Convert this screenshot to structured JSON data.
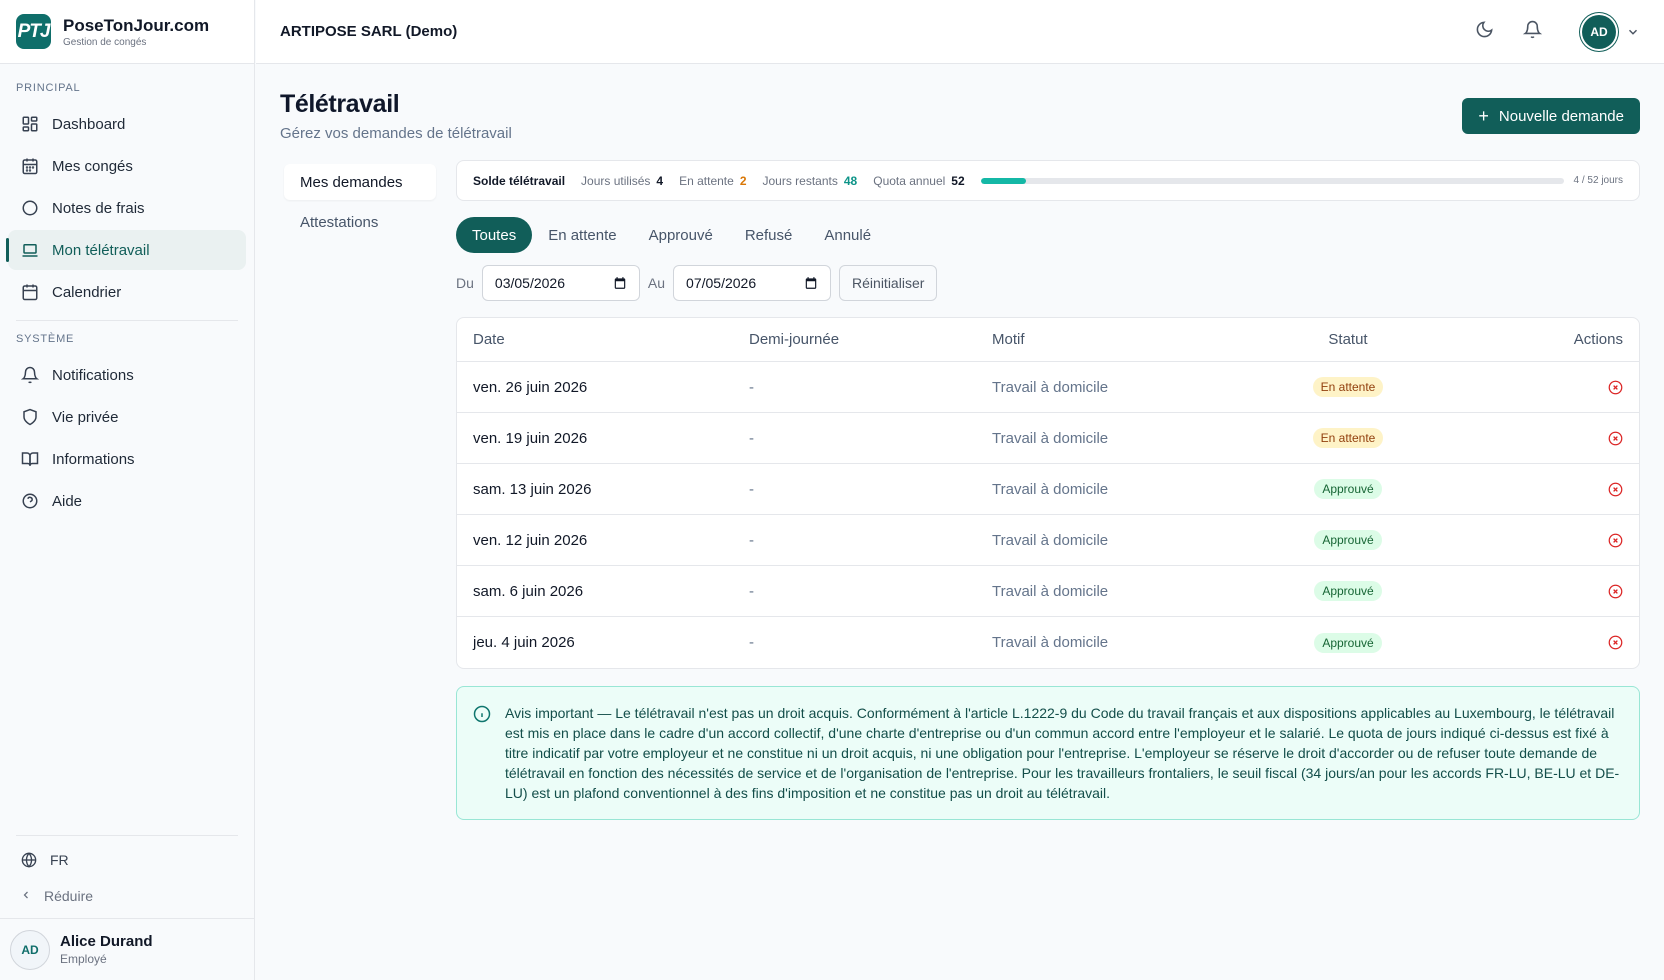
{
  "brand": {
    "logo": "PTJ",
    "name": "PoseTonJour.com",
    "tagline": "Gestion de congés"
  },
  "sidebar": {
    "principal_title": "PRINCIPAL",
    "principal_items": [
      {
        "label": "Dashboard",
        "icon": "dashboard-icon"
      },
      {
        "label": "Mes congés",
        "icon": "calendar-grid-icon"
      },
      {
        "label": "Notes de frais",
        "icon": "circle-icon"
      },
      {
        "label": "Mon télétravail",
        "icon": "laptop-icon",
        "active": true
      },
      {
        "label": "Calendrier",
        "icon": "calendar-icon"
      }
    ],
    "system_title": "SYSTÈME",
    "system_items": [
      {
        "label": "Notifications",
        "icon": "bell-icon"
      },
      {
        "label": "Vie privée",
        "icon": "shield-icon"
      },
      {
        "label": "Informations",
        "icon": "book-icon"
      },
      {
        "label": "Aide",
        "icon": "help-icon"
      }
    ],
    "language": "FR",
    "collapse_label": "Réduire",
    "user": {
      "initials": "AD",
      "name": "Alice Durand",
      "role": "Employé"
    }
  },
  "header": {
    "company": "ARTIPOSE SARL (Demo)",
    "avatar_initials": "AD"
  },
  "page": {
    "title": "Télétravail",
    "subtitle": "Gérez vos demandes de télétravail",
    "new_button": "Nouvelle demande",
    "subnav": [
      "Mes demandes",
      "Attestations"
    ]
  },
  "balance": {
    "title": "Solde télétravail",
    "used_label": "Jours utilisés",
    "used_value": "4",
    "pending_label": "En attente",
    "pending_value": "2",
    "remaining_label": "Jours restants",
    "remaining_value": "48",
    "quota_label": "Quota annuel",
    "quota_value": "52",
    "progress_fraction": 0.077,
    "progress_text": "4 / 52 jours"
  },
  "tabs": [
    "Toutes",
    "En attente",
    "Approuvé",
    "Refusé",
    "Annulé"
  ],
  "filters": {
    "from_label": "Du",
    "from_value": "03/05/2026",
    "to_label": "Au",
    "to_value": "07/05/2026",
    "reset_label": "Réinitialiser"
  },
  "table": {
    "headers": [
      "Date",
      "Demi-journée",
      "Motif",
      "Statut",
      "Actions"
    ],
    "rows": [
      {
        "date": "ven. 26 juin 2026",
        "half": "-",
        "motif": "Travail à domicile",
        "status": "En attente",
        "kind": "pending"
      },
      {
        "date": "ven. 19 juin 2026",
        "half": "-",
        "motif": "Travail à domicile",
        "status": "En attente",
        "kind": "pending"
      },
      {
        "date": "sam. 13 juin 2026",
        "half": "-",
        "motif": "Travail à domicile",
        "status": "Approuvé",
        "kind": "approved"
      },
      {
        "date": "ven. 12 juin 2026",
        "half": "-",
        "motif": "Travail à domicile",
        "status": "Approuvé",
        "kind": "approved"
      },
      {
        "date": "sam. 6 juin 2026",
        "half": "-",
        "motif": "Travail à domicile",
        "status": "Approuvé",
        "kind": "approved"
      },
      {
        "date": "jeu. 4 juin 2026",
        "half": "-",
        "motif": "Travail à domicile",
        "status": "Approuvé",
        "kind": "approved"
      }
    ]
  },
  "notice": "Avis important — Le télétravail n'est pas un droit acquis. Conformément à l'article L.1222-9 du Code du travail français et aux dispositions applicables au Luxembourg, le télétravail est mis en place dans le cadre d'un accord collectif, d'une charte d'entreprise ou d'un commun accord entre l'employeur et le salarié. Le quota de jours indiqué ci-dessus est fixé à titre indicatif par votre employeur et ne constitue ni un droit acquis, ni une obligation pour l'entreprise. L'employeur se réserve le droit d'accorder ou de refuser toute demande de télétravail en fonction des nécessités de service et de l'organisation de l'entreprise. Pour les travailleurs frontaliers, le seuil fiscal (34 jours/an pour les accords FR-LU, BE-LU et DE-LU) est un plafond conventionnel à des fins d'imposition et ne constitue pas un droit au télétravail.",
  "colors": {
    "primary": "#115e59",
    "accent": "#14b8a6",
    "pending": "#d97706",
    "remaining": "#0d9488",
    "danger": "#dc2626"
  }
}
